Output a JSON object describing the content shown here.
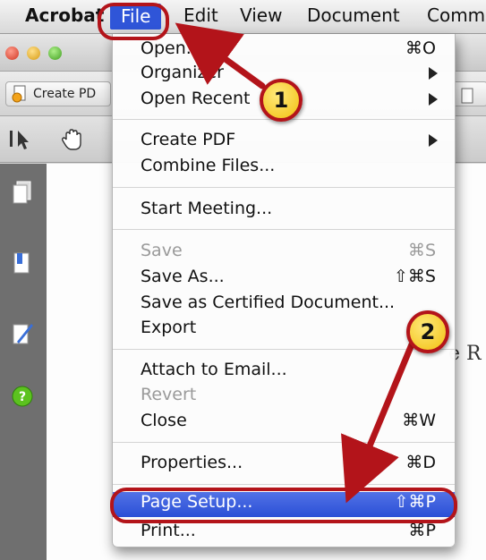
{
  "menubar": {
    "app": "Acrobat",
    "items": [
      "File",
      "Edit",
      "View",
      "Document",
      "Comm"
    ]
  },
  "toolbar": {
    "create_pdf": "Create PD"
  },
  "document": {
    "visible_text": "e R"
  },
  "file_menu": {
    "items": [
      {
        "label": "Open...",
        "shortcut": "⌘O",
        "state": "normal"
      },
      {
        "label": "Organizer",
        "submenu": true,
        "state": "normal"
      },
      {
        "label": "Open Recent",
        "submenu": true,
        "state": "normal"
      },
      {
        "label": "Create PDF",
        "submenu": true,
        "state": "normal"
      },
      {
        "label": "Combine Files...",
        "state": "normal"
      },
      {
        "label": "Start Meeting...",
        "state": "normal"
      },
      {
        "label": "Save",
        "shortcut": "⌘S",
        "state": "disabled"
      },
      {
        "label": "Save As...",
        "shortcut": "⇧⌘S",
        "state": "normal"
      },
      {
        "label": "Save as Certified Document...",
        "state": "normal"
      },
      {
        "label": "Export",
        "state": "normal"
      },
      {
        "label": "Attach to Email...",
        "state": "normal"
      },
      {
        "label": "Revert",
        "state": "disabled"
      },
      {
        "label": "Close",
        "shortcut": "⌘W",
        "state": "normal"
      },
      {
        "label": "Properties...",
        "shortcut": "⌘D",
        "state": "normal"
      },
      {
        "label": "Page Setup...",
        "shortcut": "⇧⌘P",
        "state": "highlighted"
      },
      {
        "label": "Print...",
        "shortcut": "⌘P",
        "state": "normal"
      }
    ]
  },
  "callouts": {
    "step1": "1",
    "step2": "2"
  },
  "colors": {
    "highlight": "#2a4fd6",
    "callout_border": "#b3141a",
    "callout_fill": "#f2c010"
  }
}
